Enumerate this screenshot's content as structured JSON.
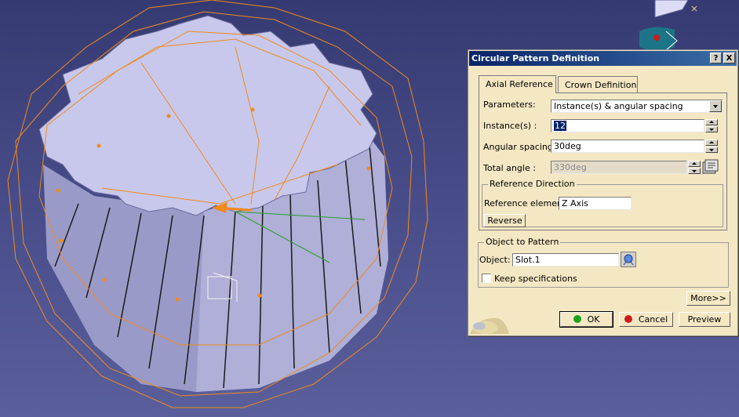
{
  "dialog": {
    "title": "Circular Pattern Definition",
    "help_label": "?",
    "close_label": "X",
    "tabs": [
      {
        "label": "Axial Reference",
        "active": true
      },
      {
        "label": "Crown Definition",
        "active": false
      }
    ],
    "parameters": {
      "label": "Parameters:",
      "value": "Instance(s) & angular spacing"
    },
    "instances": {
      "label": "Instance(s) :",
      "value": "12"
    },
    "angular_spacing": {
      "label": "Angular spacing :",
      "value": "30deg"
    },
    "total_angle": {
      "label": "Total angle :",
      "value": "330deg"
    },
    "reference_direction": {
      "title": "Reference Direction",
      "element_label": "Reference element:",
      "element_value": "Z Axis",
      "reverse_label": "Reverse"
    },
    "object_to_pattern": {
      "title": "Object to Pattern",
      "object_label": "Object:",
      "object_value": "Slot.1",
      "keep_spec_label": "Keep specifications",
      "keep_spec_checked": false
    },
    "more_label": "More>>",
    "ok_label": "OK",
    "cancel_label": "Cancel",
    "preview_label": "Preview"
  },
  "colors": {
    "background": "#3f4480",
    "gear_face": "#c8c8ec",
    "wireframe": "#f08a1a",
    "dialog_bg": "#f4e7c3",
    "title_bar": "#0a246a",
    "ok_dot": "#1ca21c",
    "cancel_dot": "#c81e1e"
  },
  "icons": {
    "compass": "compass-icon",
    "formula": "formula-icon",
    "object_select": "selection-icon"
  }
}
